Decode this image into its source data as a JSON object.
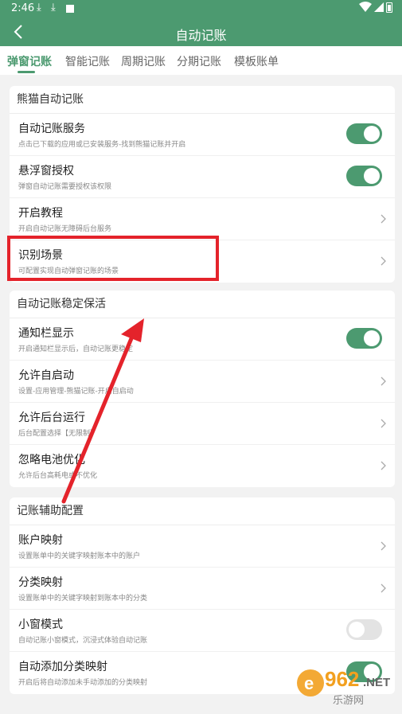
{
  "status_bar": {
    "time": "2:46"
  },
  "header": {
    "title": "自动记账"
  },
  "tabs": [
    {
      "label": "弹窗记账"
    },
    {
      "label": "智能记账"
    },
    {
      "label": "周期记账"
    },
    {
      "label": "分期记账"
    },
    {
      "label": "模板账单"
    }
  ],
  "sections": [
    {
      "title": "熊猫自动记账",
      "rows": [
        {
          "label": "自动记账服务",
          "sub": "点击已下载的应用或已安装服务-找到熊猫记账并开启"
        },
        {
          "label": "悬浮窗授权",
          "sub": "弹窗自动记账需要授权该权限"
        },
        {
          "label": "开启教程",
          "sub": "开启自动记账无障碍后台服务"
        },
        {
          "label": "识别场景",
          "sub": "可配置实现自动弹窗记账的场景"
        }
      ]
    },
    {
      "title": "自动记账稳定保活",
      "rows": [
        {
          "label": "通知栏显示",
          "sub": "开启通知栏显示后，自动记账更稳定"
        },
        {
          "label": "允许自启动",
          "sub": "设置-应用管理-熊猫记账-开启自启动"
        },
        {
          "label": "允许后台运行",
          "sub": "后台配置选择【无限制】"
        },
        {
          "label": "忽略电池优化",
          "sub": "允许后台高耗电或不优化"
        }
      ]
    },
    {
      "title": "记账辅助配置",
      "rows": [
        {
          "label": "账户映射",
          "sub": "设置账单中的关键字映射账本中的账户"
        },
        {
          "label": "分类映射",
          "sub": "设置账单中的关键字映射到账本中的分类"
        },
        {
          "label": "小窗模式",
          "sub": "自动记账小窗模式，沉浸式体验自动记账"
        },
        {
          "label": "自动添加分类映射",
          "sub": "开启后将自动添加未手动添加的分类映射"
        }
      ]
    }
  ],
  "toggles": {
    "auto_service": true,
    "overlay_permission": true,
    "notification_display": true,
    "mini_window": false,
    "auto_add_category": true
  },
  "watermark": {
    "brand": "962.NET",
    "name": "乐游网"
  },
  "colors": {
    "primary": "#4c9a70",
    "highlight": "#e4232b"
  }
}
